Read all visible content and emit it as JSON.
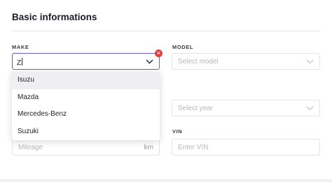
{
  "section": {
    "title": "Basic informations"
  },
  "make": {
    "label": "MAKE",
    "value": "Z",
    "clear_icon": "close-icon",
    "chevron_icon": "chevron-down-icon",
    "options": [
      "Isuzu",
      "Mazda",
      "Mercedes-Benz",
      "Suzuki"
    ],
    "highlighted_index": 0
  },
  "model": {
    "label": "MODEL",
    "placeholder": "Select model",
    "chevron_icon": "chevron-down-icon"
  },
  "year": {
    "placeholder": "Select year",
    "chevron_icon": "chevron-down-icon"
  },
  "mileage": {
    "placeholder": "Mileage",
    "unit": "km"
  },
  "vin": {
    "label": "VIN",
    "placeholder": "Enter VIN"
  },
  "colors": {
    "accent": "#6f56d9",
    "clear": "#e63b3b",
    "highlight": "#efeef2"
  }
}
